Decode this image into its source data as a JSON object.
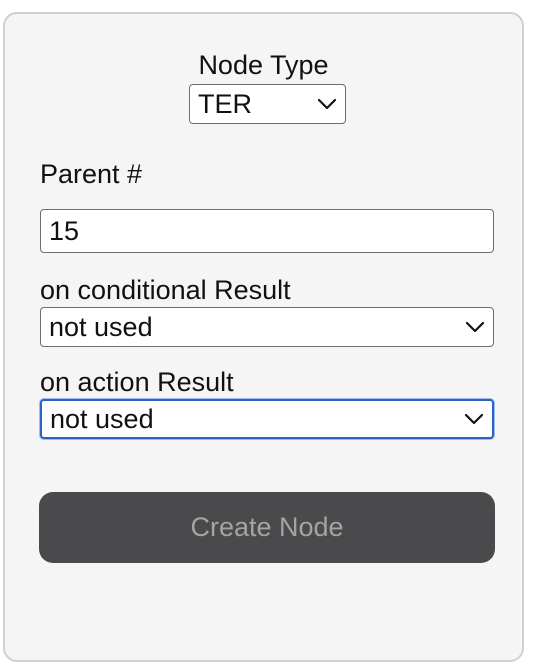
{
  "form": {
    "node_type_label": "Node Type",
    "node_type_value": "TER",
    "parent_label": "Parent #",
    "parent_value": "15",
    "on_conditional_label": "on conditional Result",
    "on_conditional_value": "not used",
    "on_action_label": "on action Result",
    "on_action_value": "not used",
    "create_button_label": "Create Node"
  },
  "icons": {
    "select_arrow": "chevron-down-icon"
  },
  "colors": {
    "panel_background": "#f5f5f5",
    "focus_border": "#2a63c4",
    "button_background": "#4a494b",
    "button_text": "#a4a4a4"
  }
}
